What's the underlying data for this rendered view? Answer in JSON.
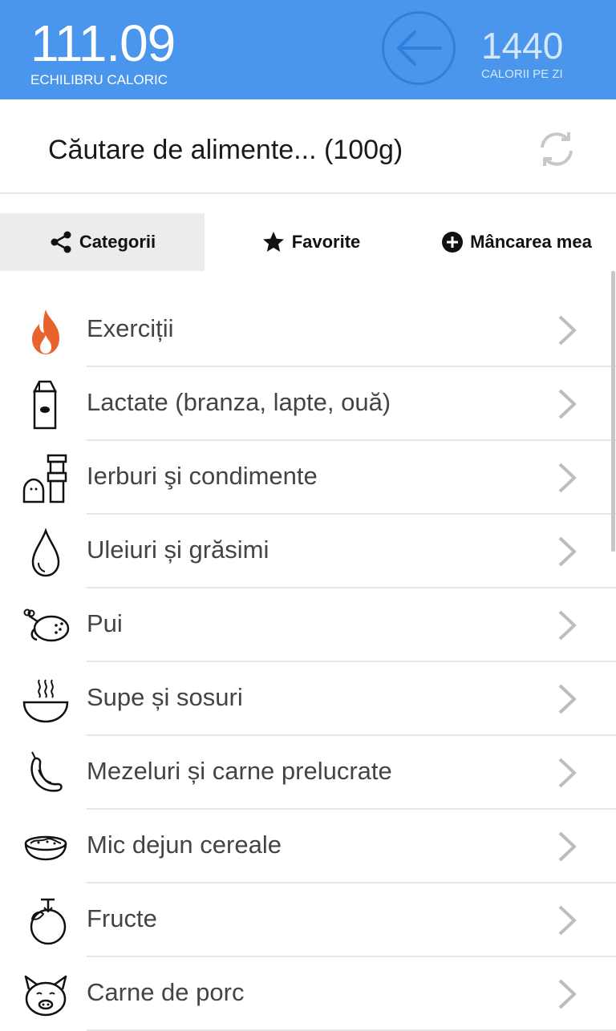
{
  "header": {
    "balance_value": "111.09",
    "balance_label": "ECHILIBRU CALORIC",
    "daily_value": "1440",
    "daily_label": "CALORII PE ZI",
    "color": "#4996ec"
  },
  "search": {
    "text": "Căutare de alimente... (100g)"
  },
  "tabs": [
    {
      "label": "Categorii",
      "icon": "share-icon",
      "selected": true
    },
    {
      "label": "Favorite",
      "icon": "star-icon",
      "selected": false
    },
    {
      "label": "Mâncarea mea",
      "icon": "plus-circle-icon",
      "selected": false
    }
  ],
  "categories": [
    {
      "label": "Exerciții",
      "icon": "fire-icon"
    },
    {
      "label": "Lactate (branza, lapte, ouă)",
      "icon": "milk-carton-icon"
    },
    {
      "label": "Ierburi şi condimente",
      "icon": "spice-shaker-icon"
    },
    {
      "label": "Uleiuri și grăsimi",
      "icon": "oil-drop-icon"
    },
    {
      "label": "Pui",
      "icon": "roast-chicken-icon"
    },
    {
      "label": "Supe și sosuri",
      "icon": "soup-bowl-icon"
    },
    {
      "label": "Mezeluri și carne prelucrate",
      "icon": "sausage-icon"
    },
    {
      "label": "Mic dejun cereale",
      "icon": "cereal-bowl-icon"
    },
    {
      "label": "Fructe",
      "icon": "fruit-icon"
    },
    {
      "label": "Carne de porc",
      "icon": "pig-icon"
    }
  ]
}
